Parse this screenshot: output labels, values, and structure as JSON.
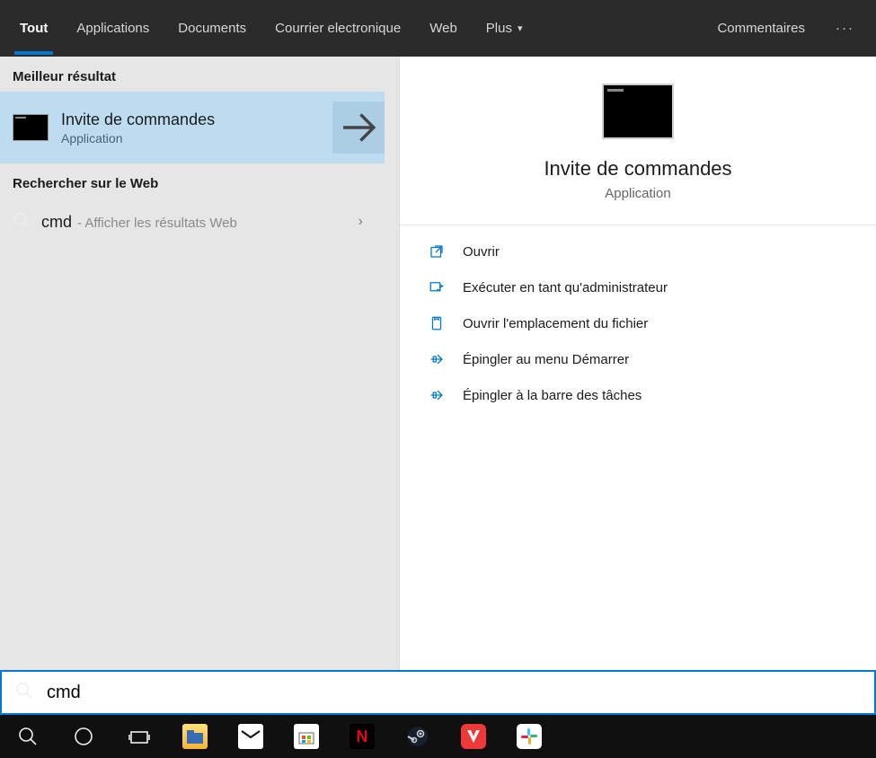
{
  "tabs": {
    "tout": "Tout",
    "applications": "Applications",
    "documents": "Documents",
    "courrier": "Courrier electronique",
    "web": "Web",
    "plus": "Plus",
    "commentaires": "Commentaires"
  },
  "left": {
    "best_header": "Meilleur résultat",
    "best": {
      "title": "Invite de commandes",
      "subtitle": "Application"
    },
    "web_header": "Rechercher sur le Web",
    "web": {
      "term": "cmd",
      "desc": "- Afficher les résultats Web"
    }
  },
  "preview": {
    "title": "Invite de commandes",
    "subtitle": "Application",
    "actions": {
      "open": "Ouvrir",
      "admin": "Exécuter en tant qu'administrateur",
      "location": "Ouvrir l'emplacement du fichier",
      "pin_start": "Épingler au menu Démarrer",
      "pin_task": "Épingler à la barre des tâches"
    }
  },
  "search": {
    "value": "cmd"
  },
  "taskbar": {
    "netflix": "N"
  }
}
